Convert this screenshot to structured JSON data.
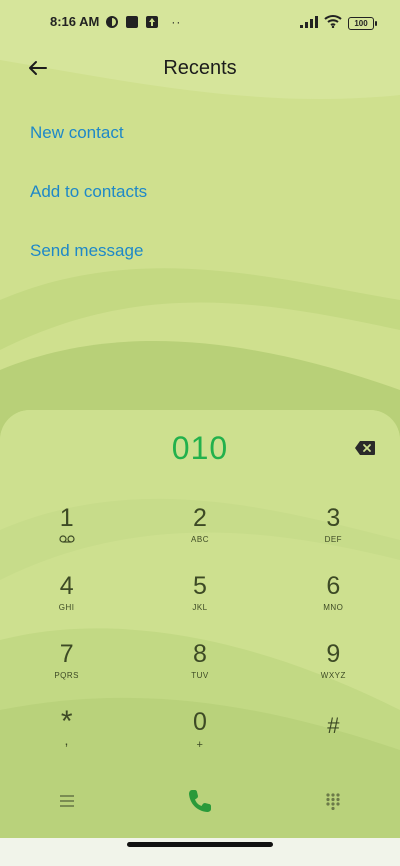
{
  "status_bar": {
    "time": "8:16 AM",
    "battery": "100",
    "icons": [
      "app-icon",
      "square-icon",
      "upload-icon",
      "more-dots-icon",
      "signal-icon",
      "wifi-icon",
      "battery-icon"
    ],
    "dots": "··"
  },
  "header": {
    "title": "Recents",
    "back_icon": "arrow-left-icon"
  },
  "actions": [
    {
      "label": "New contact"
    },
    {
      "label": "Add to contacts"
    },
    {
      "label": "Send message"
    }
  ],
  "dialer": {
    "number": "010",
    "keys": [
      {
        "digit": "1",
        "letters": "voicemail-icon"
      },
      {
        "digit": "2",
        "letters": "ABC"
      },
      {
        "digit": "3",
        "letters": "DEF"
      },
      {
        "digit": "4",
        "letters": "GHI"
      },
      {
        "digit": "5",
        "letters": "JKL"
      },
      {
        "digit": "6",
        "letters": "MNO"
      },
      {
        "digit": "7",
        "letters": "PQRS"
      },
      {
        "digit": "8",
        "letters": "TUV"
      },
      {
        "digit": "9",
        "letters": "WXYZ"
      },
      {
        "digit": "*",
        "letters": ","
      },
      {
        "digit": "0",
        "letters": "+"
      },
      {
        "digit": "#",
        "letters": ""
      }
    ],
    "bottom_icons": [
      "menu-icon",
      "phone-call-icon",
      "keypad-grid-icon"
    ]
  },
  "colors": {
    "accent_link": "#1e88c8",
    "number_green": "#22b14c",
    "call_green": "#2a9a3a",
    "key_text": "#3d4a25",
    "background": "#cfe08e"
  }
}
